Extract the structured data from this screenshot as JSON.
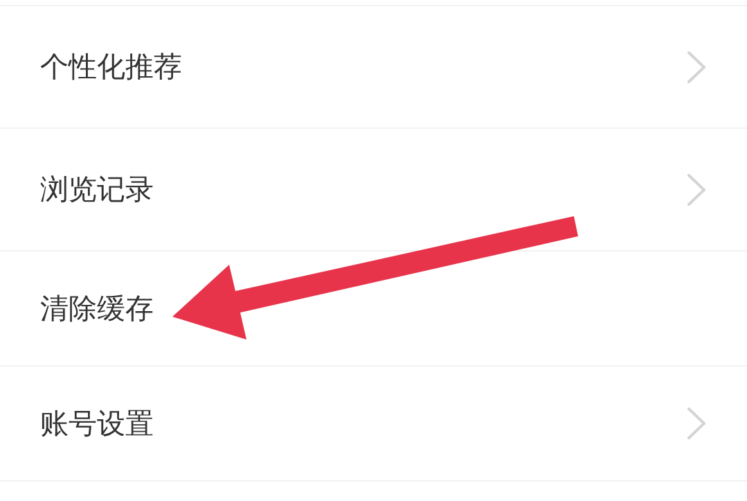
{
  "rows": [
    {
      "label": "个性化推荐",
      "chevron": true,
      "pointed": false
    },
    {
      "label": "浏览记录",
      "chevron": true,
      "pointed": false
    },
    {
      "label": "清除缓存",
      "chevron": false,
      "pointed": true
    },
    {
      "label": "账号设置",
      "chevron": true,
      "pointed": false
    }
  ]
}
